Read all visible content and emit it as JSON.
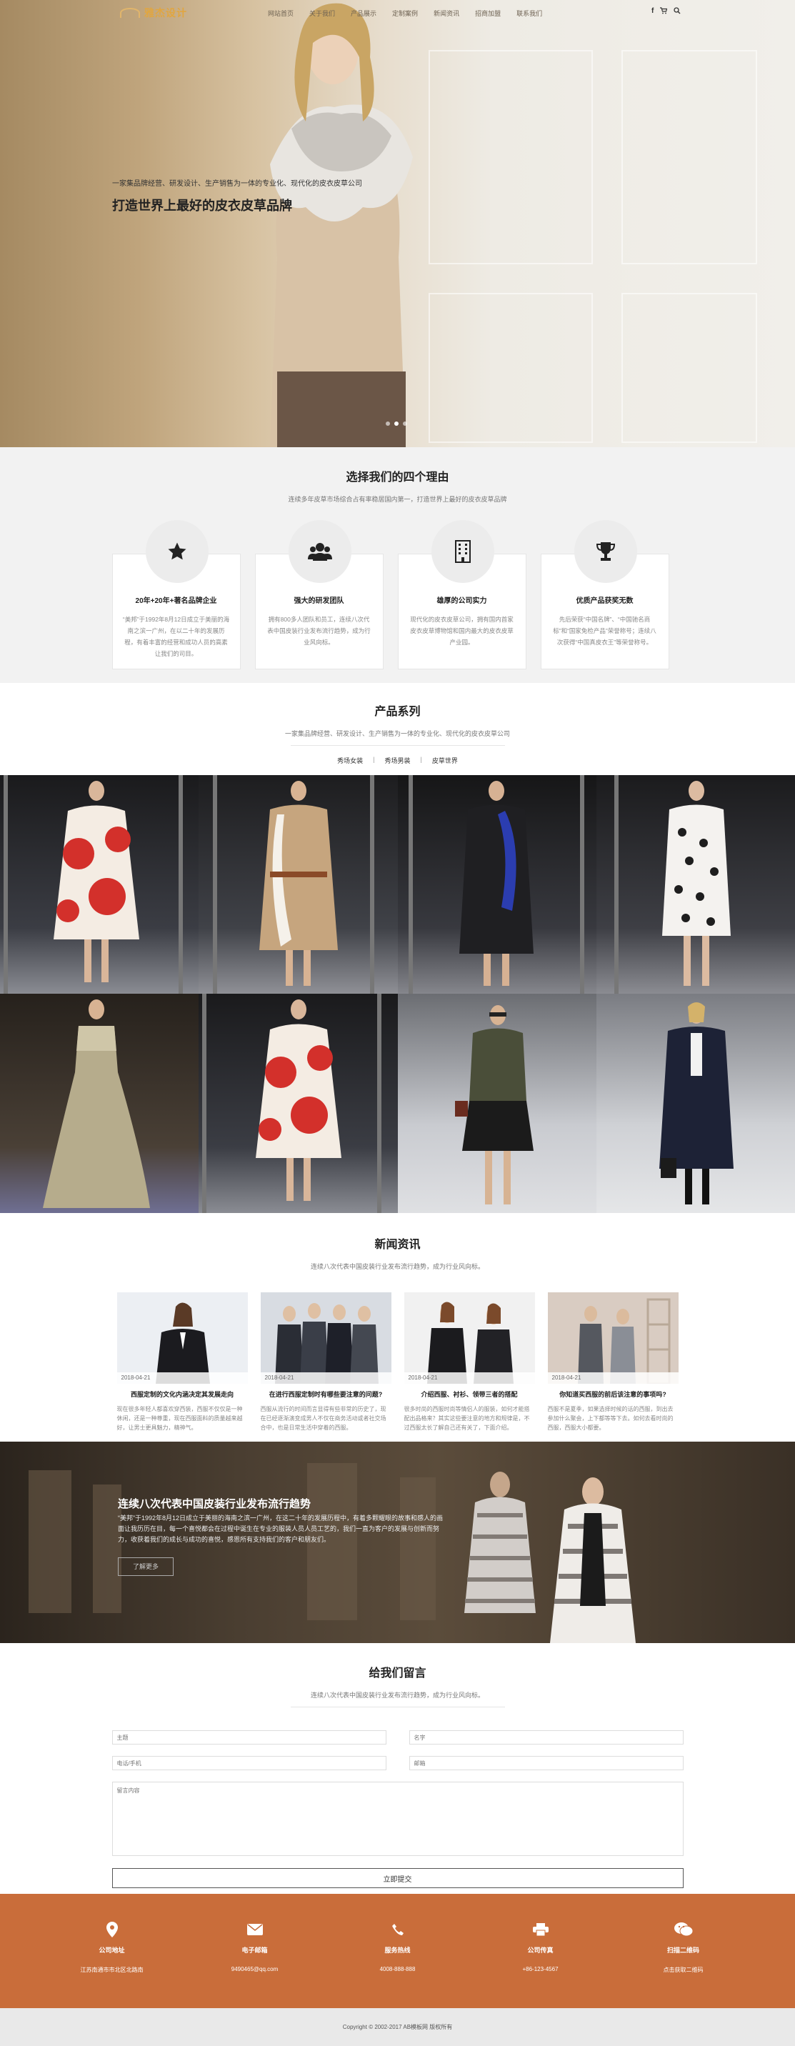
{
  "nav": {
    "logo_text": "雅杰设计",
    "menu": [
      "网站首页",
      "关于我们",
      "产品展示",
      "定制案例",
      "新闻资讯",
      "招商加盟",
      "联系我们"
    ]
  },
  "hero": {
    "subtitle": "一家集品牌经营、研发设计、生产销售为一体的专业化、现代化的皮衣皮草公司",
    "title": "打造世界上最好的皮衣皮草品牌"
  },
  "reasons": {
    "title": "选择我们的四个理由",
    "subtitle": "连续多年皮草市场综合占有率稳居国内第一，打造世界上最好的皮衣皮草品牌",
    "cards": [
      {
        "icon": "star-icon",
        "title": "20年+20年+著名品牌企业",
        "text": "“美邦”于1992年8月12日成立于美丽的海南之滨一广州，在以二十年的发展历程，有着丰富的经营和成功人员的高素让我们的司目。"
      },
      {
        "icon": "users-icon",
        "title": "强大的研发团队",
        "text": "拥有800多人团队和员工，连续八次代表中国皮装行业发布流行趋势，成为行业风向标。"
      },
      {
        "icon": "building-icon",
        "title": "雄厚的公司实力",
        "text": "现代化的皮衣皮草公司，拥有国内首家皮衣皮草博物馆和国内最大的皮衣皮草产业园。"
      },
      {
        "icon": "trophy-icon",
        "title": "优质产品获奖无数",
        "text": "先后荣获“中国名牌”、“中国驰名商标”和“国家免检产品”荣誉称号；连续八次获得“中国真皮衣王”等荣誉称号。"
      }
    ]
  },
  "products": {
    "title": "产品系列",
    "subtitle": "一家集品牌经营、研发设计、生产销售为一体的专业化、现代化的皮衣皮草公司",
    "tabs": [
      "秀场女装",
      "秀场男装",
      "皮草世界"
    ]
  },
  "news": {
    "title": "新闻资讯",
    "subtitle": "连续八次代表中国皮装行业发布流行趋势，成为行业风向标。",
    "items": [
      {
        "date": "2018-04-21",
        "title": "西服定制的文化内涵决定其发展走向",
        "text": "现在很多年轻人都喜欢穿西装，西服不仅仅是一种休闲，还是一种尊重，现在西服面料的质量越来越好，让男士更具魅力，精神气。"
      },
      {
        "date": "2018-04-21",
        "title": "在进行西服定制时有哪些要注意的问题?",
        "text": "西服从流行的时间而言显得有些非常的历史了，现在已经逐渐演变成男人不仅在商务活动或者社交场合中，也是日常生活中穿着的西服。"
      },
      {
        "date": "2018-04-21",
        "title": "介绍西服、衬衫、领带三者的搭配",
        "text": "很多时尚的西服时尚等情侣人的服装，如何才能搭配出品格来？其实这些要注意的地方和规律是，不过西服太长了解自己还有关了，下面介绍。"
      },
      {
        "date": "2018-04-21",
        "title": "你知道买西服的前后该注意的事项吗?",
        "text": "西服不是夏季，如果选择时候的话的西服，到出去参加什么聚会，上下都等等下去。如何去看时尚的西服，西服大小都要。"
      }
    ]
  },
  "banner": {
    "title": "连续八次代表中国皮装行业发布流行趋势",
    "text": "“美邦”于1992年8月12日成立于美丽的海南之滨一广州，在这二十年的发展历程中，有着多颗耀眼的故事和感人的画面让我历历在目，每一个喜悦都会在过程中诞生在专业的服装人员人员工艺的，我们一直为客户的发展与创新而努力，收获着我们的成长与成功的喜悦，感恩所有支持我们的客户和朋友们。",
    "button": "了解更多"
  },
  "contact": {
    "title": "给我们留言",
    "subtitle": "连续八次代表中国皮装行业发布流行趋势，成为行业风向标。",
    "fields": {
      "subject": "主题",
      "name": "名字",
      "phone": "电话/手机",
      "email": "邮箱",
      "message": "留言内容"
    },
    "submit": "立即提交"
  },
  "footer": {
    "columns": [
      {
        "icon": "location-icon",
        "title": "公司地址",
        "value": "江苏南通市市北区北路南"
      },
      {
        "icon": "envelope-icon",
        "title": "电子邮箱",
        "value": "9490465@qq.com"
      },
      {
        "icon": "phone-icon",
        "title": "服务热线",
        "value": "4008-888-888"
      },
      {
        "icon": "printer-icon",
        "title": "公司传真",
        "value": "+86-123-4567"
      },
      {
        "icon": "wechat-icon",
        "title": "扫描二维码",
        "value": "点击获取二维码"
      }
    ],
    "copyright": "Copyright © 2002-2017 AB模板网 版权所有"
  },
  "colors": {
    "accent": "#c96d3a",
    "logo": "#e1a640",
    "footer_bg": "#e9e9e9"
  }
}
